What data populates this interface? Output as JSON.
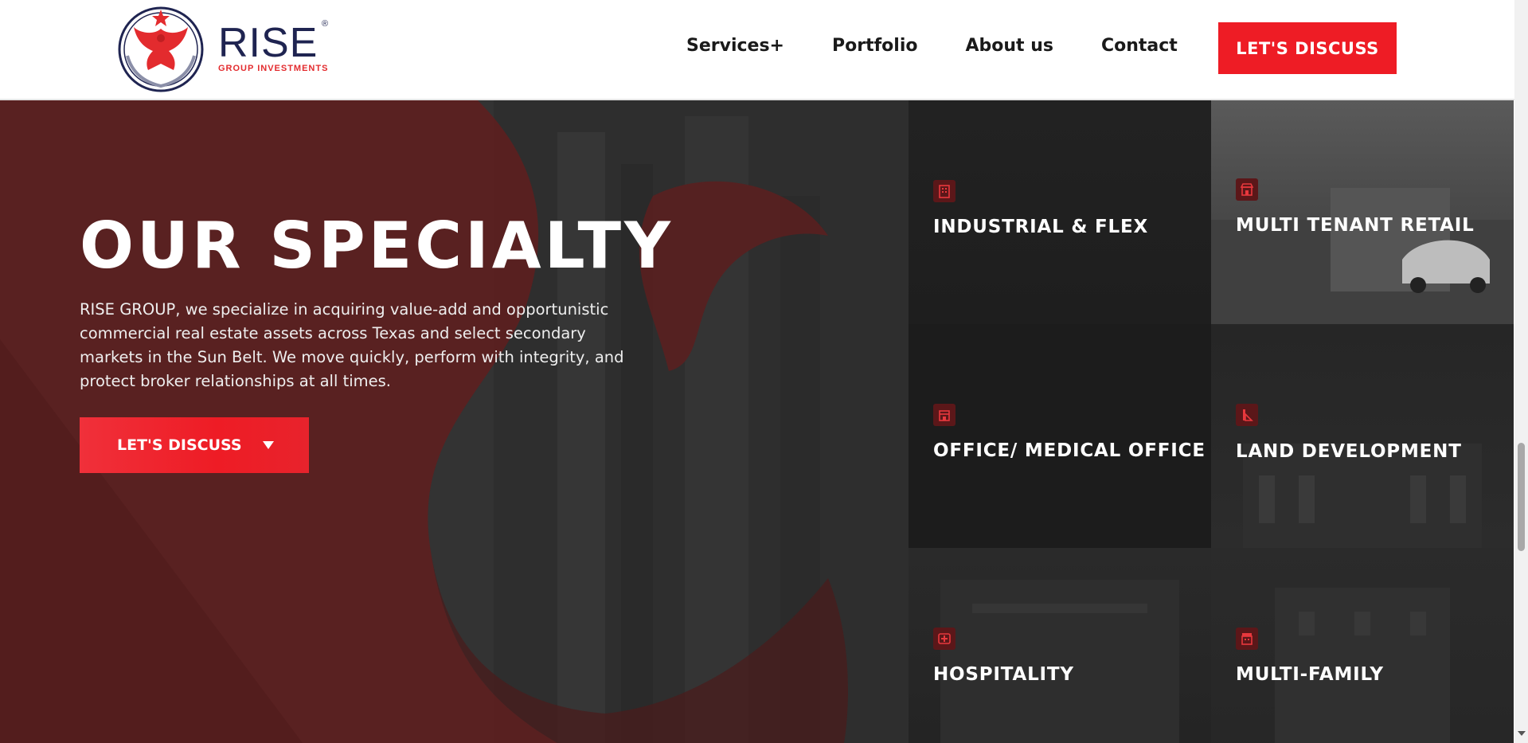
{
  "header": {
    "logo": {
      "name": "RISE",
      "registered": "®",
      "tagline": "GROUP INVESTMENTS"
    },
    "nav": [
      {
        "label": "Services+"
      },
      {
        "label": "Portfolio"
      },
      {
        "label": "About us"
      },
      {
        "label": "Contact"
      }
    ],
    "cta_label": "LET'S DISCUSS"
  },
  "hero": {
    "title": "OUR SPECIALTY",
    "description": "RISE GROUP, we specialize in acquiring value-add and opportunistic commercial real estate assets across Texas and select secondary markets in the Sun Belt. We move quickly, perform with integrity, and protect broker relationships at all times.",
    "cta_label": "LET'S DISCUSS"
  },
  "specialties": [
    {
      "label": "INDUSTRIAL & FLEX",
      "icon": "building-icon"
    },
    {
      "label": "MULTI TENANT RETAIL",
      "icon": "storefront-icon"
    },
    {
      "label": "OFFICE/ MEDICAL OFFICE",
      "icon": "office-icon"
    },
    {
      "label": "LAND DEVELOPMENT",
      "icon": "land-icon"
    },
    {
      "label": "HOSPITALITY",
      "icon": "medical-cross-icon"
    },
    {
      "label": "MULTI-FAMILY",
      "icon": "apartment-icon"
    }
  ],
  "colors": {
    "accent": "#ee1c25",
    "brand_navy": "#1f2451",
    "hero_red": "#5c1f1f",
    "dark_tile": "#1c1c1c"
  }
}
